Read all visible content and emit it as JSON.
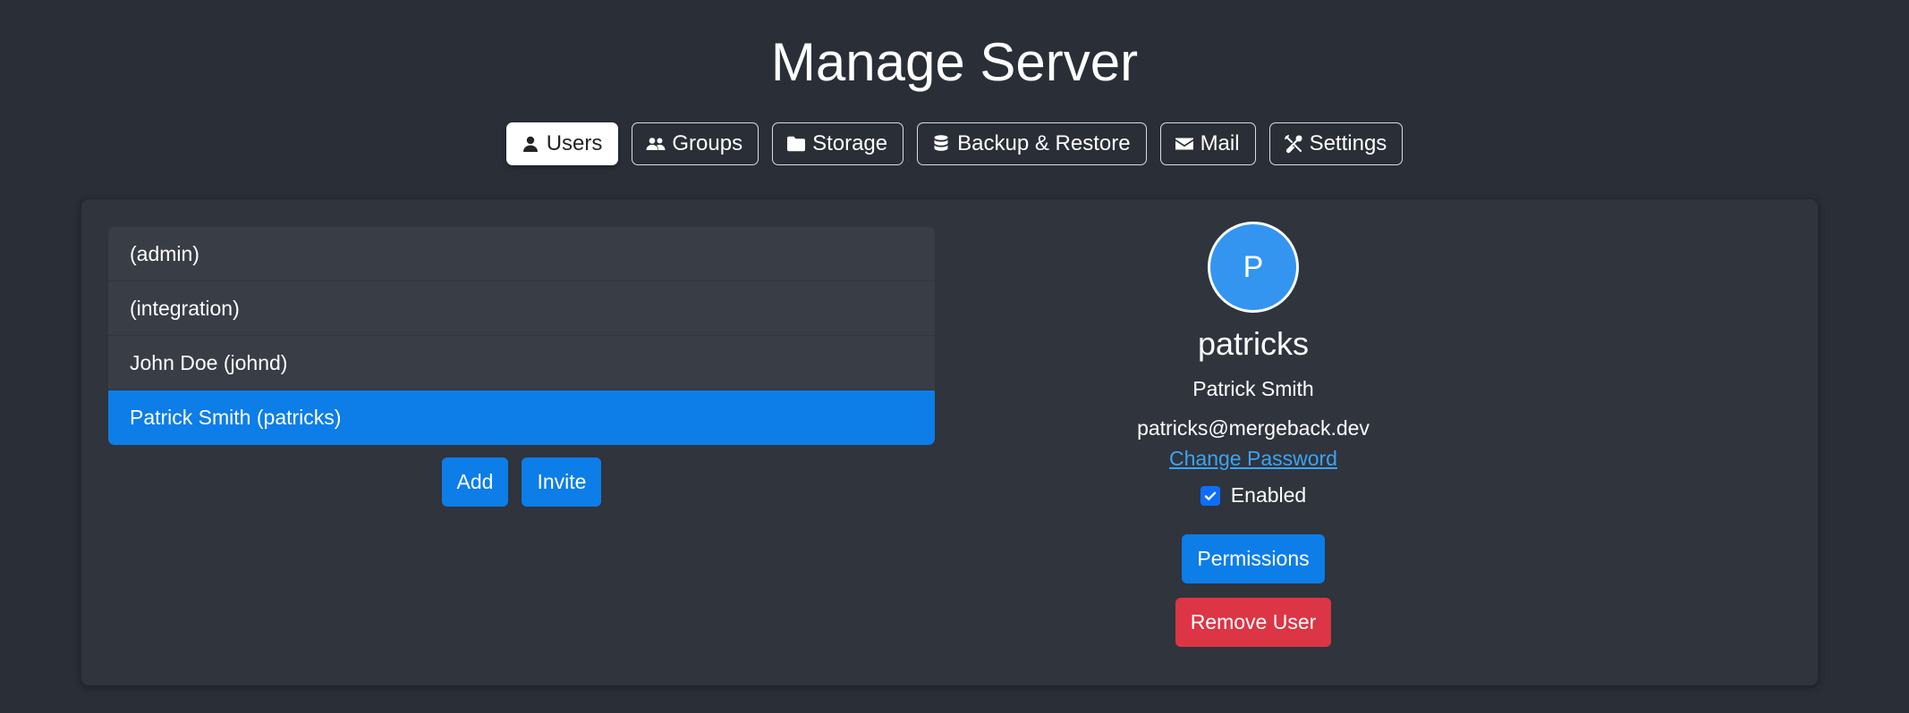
{
  "page": {
    "title": "Manage Server"
  },
  "tabs": [
    {
      "label": "Users",
      "icon": "user-icon",
      "active": true
    },
    {
      "label": "Groups",
      "icon": "users-icon",
      "active": false
    },
    {
      "label": "Storage",
      "icon": "folder-icon",
      "active": false
    },
    {
      "label": "Backup & Restore",
      "icon": "database-icon",
      "active": false
    },
    {
      "label": "Mail",
      "icon": "envelope-icon",
      "active": false
    },
    {
      "label": "Settings",
      "icon": "tools-icon",
      "active": false
    }
  ],
  "users": {
    "items": [
      {
        "label": "(admin)",
        "selected": false
      },
      {
        "label": "(integration)",
        "selected": false
      },
      {
        "label": "John Doe (johnd)",
        "selected": false
      },
      {
        "label": "Patrick Smith (patricks)",
        "selected": true
      }
    ],
    "add_label": "Add",
    "invite_label": "Invite"
  },
  "details": {
    "avatar_initial": "P",
    "username": "patricks",
    "full_name": "Patrick Smith",
    "email": "patricks@mergeback.dev",
    "change_password_label": "Change Password",
    "enabled_label": "Enabled",
    "enabled": true,
    "permissions_label": "Permissions",
    "remove_label": "Remove User"
  },
  "colors": {
    "background": "#2a2e37",
    "panel": "#30343d",
    "primary": "#0d7de8",
    "danger": "#dc3545",
    "link": "#3ba4f1"
  }
}
